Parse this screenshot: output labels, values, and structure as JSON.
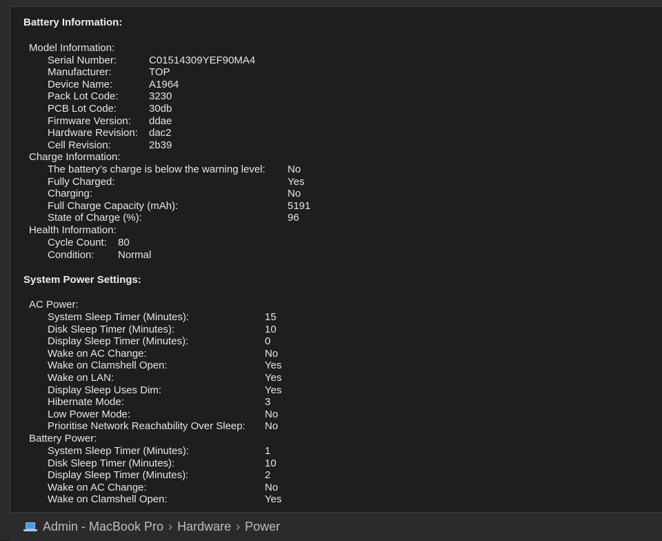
{
  "battery": {
    "title": "Battery Information:",
    "model": {
      "header": "Model Information:",
      "rows": [
        {
          "label": "Serial Number:",
          "value": "C01514309YEF90MA4"
        },
        {
          "label": "Manufacturer:",
          "value": "TOP"
        },
        {
          "label": "Device Name:",
          "value": "A1964"
        },
        {
          "label": "Pack Lot Code:",
          "value": "3230"
        },
        {
          "label": "PCB Lot Code:",
          "value": "30db"
        },
        {
          "label": "Firmware Version:",
          "value": "ddae"
        },
        {
          "label": "Hardware Revision:",
          "value": "dac2"
        },
        {
          "label": "Cell Revision:",
          "value": "2b39"
        }
      ]
    },
    "charge": {
      "header": "Charge Information:",
      "rows": [
        {
          "label": "The battery’s charge is below the warning level:",
          "value": "No"
        },
        {
          "label": "Fully Charged:",
          "value": "Yes"
        },
        {
          "label": "Charging:",
          "value": "No"
        },
        {
          "label": "Full Charge Capacity (mAh):",
          "value": "5191"
        },
        {
          "label": "State of Charge (%):",
          "value": "96"
        }
      ]
    },
    "health": {
      "header": "Health Information:",
      "rows": [
        {
          "label": "Cycle Count:",
          "value": "80"
        },
        {
          "label": "Condition:",
          "value": "Normal"
        }
      ]
    }
  },
  "power": {
    "title": "System Power Settings:",
    "ac": {
      "header": "AC Power:",
      "rows": [
        {
          "label": "System Sleep Timer (Minutes):",
          "value": "15"
        },
        {
          "label": "Disk Sleep Timer (Minutes):",
          "value": "10"
        },
        {
          "label": "Display Sleep Timer (Minutes):",
          "value": "0"
        },
        {
          "label": "Wake on AC Change:",
          "value": "No"
        },
        {
          "label": "Wake on Clamshell Open:",
          "value": "Yes"
        },
        {
          "label": "Wake on LAN:",
          "value": "Yes"
        },
        {
          "label": "Display Sleep Uses Dim:",
          "value": "Yes"
        },
        {
          "label": "Hibernate Mode:",
          "value": "3"
        },
        {
          "label": "Low Power Mode:",
          "value": "No"
        },
        {
          "label": "Prioritise Network Reachability Over Sleep:",
          "value": "No"
        }
      ]
    },
    "battery_power": {
      "header": "Battery Power:",
      "rows": [
        {
          "label": "System Sleep Timer (Minutes):",
          "value": "1"
        },
        {
          "label": "Disk Sleep Timer (Minutes):",
          "value": "10"
        },
        {
          "label": "Display Sleep Timer (Minutes):",
          "value": "2"
        },
        {
          "label": "Wake on AC Change:",
          "value": "No"
        },
        {
          "label": "Wake on Clamshell Open:",
          "value": "Yes"
        }
      ]
    }
  },
  "footer": {
    "icon": "laptop-icon",
    "crumbs": [
      "Admin - MacBook Pro",
      "Hardware",
      "Power"
    ],
    "separator": "›"
  }
}
